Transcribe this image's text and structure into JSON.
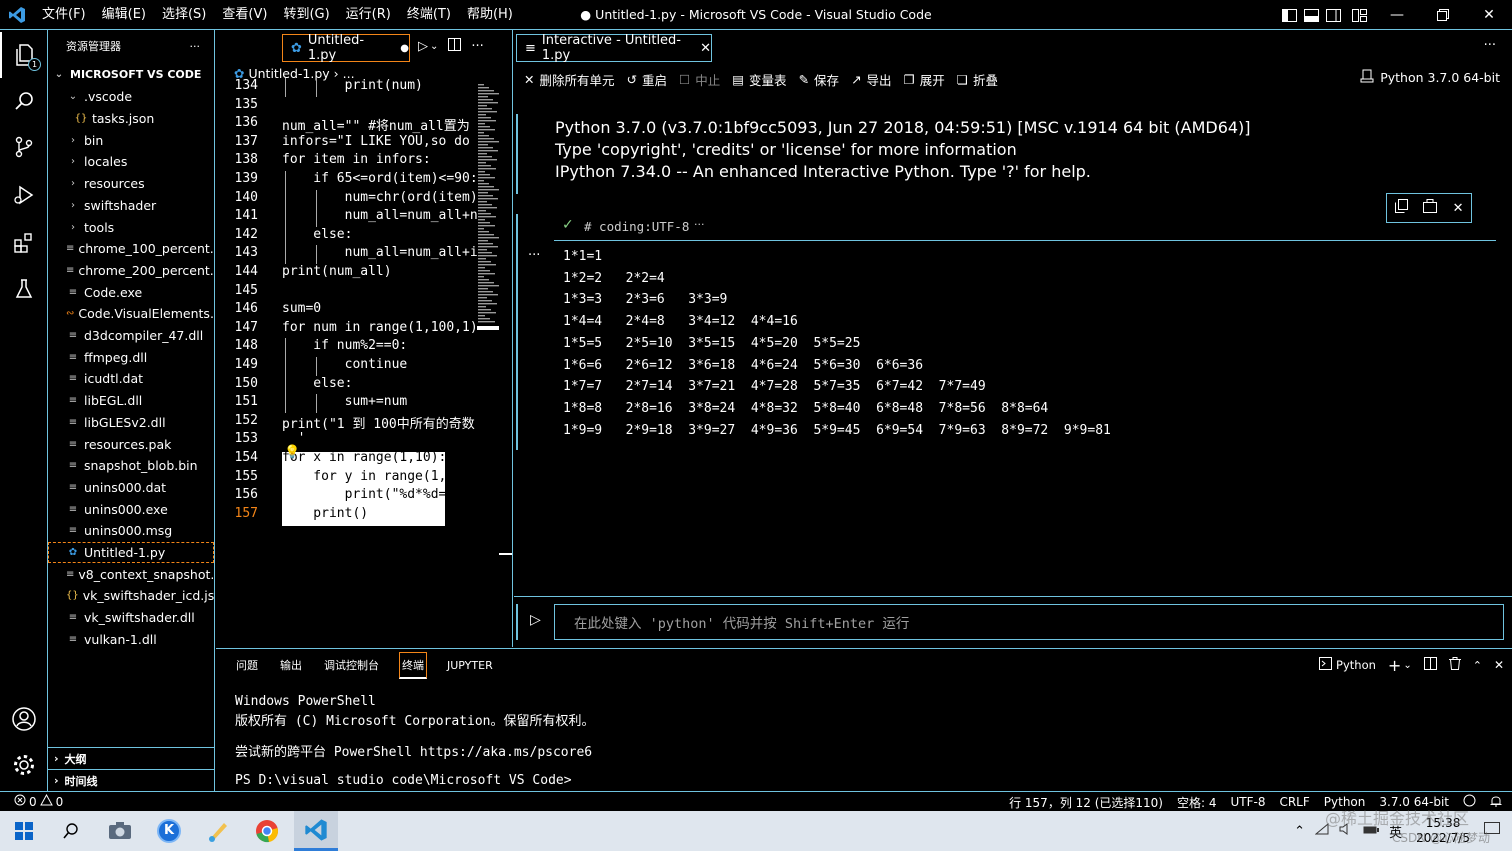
{
  "colors": {
    "accent": "#6fc3df",
    "focus": "#f38518",
    "check": "#89d185",
    "vscode_blue": "#3c9be3"
  },
  "titlebar": {
    "menu": [
      "文件(F)",
      "编辑(E)",
      "选择(S)",
      "查看(V)",
      "转到(G)",
      "运行(R)",
      "终端(T)",
      "帮助(H)"
    ],
    "title": "● Untitled-1.py - Microsoft VS Code - Visual Studio Code"
  },
  "activitybar": {
    "badge": "1"
  },
  "explorer": {
    "header": "资源管理器",
    "root": "MICROSOFT VS CODE",
    "items": [
      {
        "label": ".vscode",
        "icon": "chevron-down"
      },
      {
        "label": "tasks.json",
        "icon": "json"
      },
      {
        "label": "bin",
        "icon": "chevron-right"
      },
      {
        "label": "locales",
        "icon": "chevron-right"
      },
      {
        "label": "resources",
        "icon": "chevron-right"
      },
      {
        "label": "swiftshader",
        "icon": "chevron-right"
      },
      {
        "label": "tools",
        "icon": "chevron-right"
      },
      {
        "label": "chrome_100_percent....",
        "icon": "file"
      },
      {
        "label": "chrome_200_percent....",
        "icon": "file"
      },
      {
        "label": "Code.exe",
        "icon": "file"
      },
      {
        "label": "Code.VisualElements...",
        "icon": "rss"
      },
      {
        "label": "d3dcompiler_47.dll",
        "icon": "file"
      },
      {
        "label": "ffmpeg.dll",
        "icon": "file"
      },
      {
        "label": "icudtl.dat",
        "icon": "file"
      },
      {
        "label": "libEGL.dll",
        "icon": "file"
      },
      {
        "label": "libGLESv2.dll",
        "icon": "file"
      },
      {
        "label": "resources.pak",
        "icon": "file"
      },
      {
        "label": "snapshot_blob.bin",
        "icon": "file"
      },
      {
        "label": "unins000.dat",
        "icon": "file"
      },
      {
        "label": "unins000.exe",
        "icon": "file"
      },
      {
        "label": "unins000.msg",
        "icon": "file"
      },
      {
        "label": "Untitled-1.py",
        "icon": "python"
      },
      {
        "label": "v8_context_snapshot....",
        "icon": "file"
      },
      {
        "label": "vk_swiftshader_icd.json",
        "icon": "json"
      },
      {
        "label": "vk_swiftshader.dll",
        "icon": "file"
      },
      {
        "label": "vulkan-1.dll",
        "icon": "file"
      }
    ],
    "outline": "大纲",
    "timeline": "时间线"
  },
  "editor": {
    "tab": "Untitled-1.py",
    "breadcrumb": "Untitled-1.py",
    "breadcrumb_tail": "...",
    "lines": [
      {
        "n": "134",
        "code": "        print(num)"
      },
      {
        "n": "135",
        "code": ""
      },
      {
        "n": "136",
        "code": "num_all=\"\" #将num_all置为"
      },
      {
        "n": "137",
        "code": "infors=\"I LIKE YOU,so do"
      },
      {
        "n": "138",
        "code": "for item in infors:"
      },
      {
        "n": "139",
        "code": "    if 65<=ord(item)<=90:"
      },
      {
        "n": "140",
        "code": "        num=chr(ord(item)"
      },
      {
        "n": "141",
        "code": "        num_all=num_all+n"
      },
      {
        "n": "142",
        "code": "    else:"
      },
      {
        "n": "143",
        "code": "        num_all=num_all+i"
      },
      {
        "n": "144",
        "code": "print(num_all)"
      },
      {
        "n": "145",
        "code": ""
      },
      {
        "n": "146",
        "code": "sum=0"
      },
      {
        "n": "147",
        "code": "for num in range(1,100,1)"
      },
      {
        "n": "148",
        "code": "    if num%2==0:"
      },
      {
        "n": "149",
        "code": "        continue"
      },
      {
        "n": "150",
        "code": "    else:"
      },
      {
        "n": "151",
        "code": "        sum+=num"
      },
      {
        "n": "152",
        "code": "print(\"1 到 100中所有的奇数"
      },
      {
        "n": "153",
        "code": "  '"
      },
      {
        "n": "154",
        "code": "for x in range(1,10):"
      },
      {
        "n": "155",
        "code": "    for y in range(1,x+1)"
      },
      {
        "n": "156",
        "code": "        print(\"%d*%d=%d\""
      },
      {
        "n": "157",
        "code": "    print()"
      }
    ]
  },
  "interactive": {
    "tab": "Interactive - Untitled-1.py",
    "toolbar": [
      {
        "icon": "close-icon",
        "label": "删除所有单元"
      },
      {
        "icon": "restart-icon",
        "label": "重启"
      },
      {
        "icon": "stop-icon",
        "label": "中止"
      },
      {
        "icon": "variables-icon",
        "label": "变量表"
      },
      {
        "icon": "save-icon",
        "label": "保存"
      },
      {
        "icon": "export-icon",
        "label": "导出"
      },
      {
        "icon": "expand-icon",
        "label": "展开"
      },
      {
        "icon": "collapse-icon",
        "label": "折叠"
      }
    ],
    "kernel": "Python 3.7.0 64-bit",
    "info": [
      "Python 3.7.0 (v3.7.0:1bf9cc5093, Jun 27 2018, 04:59:51) [MSC v.1914 64 bit (AMD64)]",
      "Type 'copyright', 'credits' or 'license' for more information",
      "IPython 7.34.0 -- An enhanced Interactive Python. Type '?' for help."
    ],
    "cell_code": "# coding:UTF-8",
    "cell_more": "···",
    "output": [
      "1*1=1",
      "1*2=2   2*2=4",
      "1*3=3   2*3=6   3*3=9",
      "1*4=4   2*4=8   3*4=12  4*4=16",
      "1*5=5   2*5=10  3*5=15  4*5=20  5*5=25",
      "1*6=6   2*6=12  3*6=18  4*6=24  5*6=30  6*6=36",
      "1*7=7   2*7=14  3*7=21  4*7=28  5*7=35  6*7=42  7*7=49",
      "1*8=8   2*8=16  3*8=24  4*8=32  5*8=40  6*8=48  7*8=56  8*8=64",
      "1*9=9   2*9=18  3*9=27  4*9=36  5*9=45  6*9=54  7*9=63  8*9=72  9*9=81"
    ],
    "input_placeholder": "在此处键入 'python' 代码并按 Shift+Enter 运行"
  },
  "panel": {
    "tabs": [
      "问题",
      "输出",
      "调试控制台",
      "终端",
      "JUPYTER"
    ],
    "active_tab": "终端",
    "terminal_type": "Python",
    "terminal": [
      "Windows PowerShell",
      "版权所有 (C) Microsoft Corporation。保留所有权利。",
      "",
      "尝试新的跨平台 PowerShell https://aka.ms/pscore6",
      "",
      "PS D:\\visual studio code\\Microsoft VS Code>"
    ]
  },
  "statusbar": {
    "errors": "0",
    "warnings": "0",
    "position": "行 157，列 12 (已选择110)",
    "spaces": "空格: 4",
    "encoding": "UTF-8",
    "eol": "CRLF",
    "language": "Python",
    "interpreter": "3.7.0 64-bit"
  },
  "taskbar": {
    "ime": "英",
    "time": "15:38",
    "date": "2022/7/5",
    "watermark": "@稀土掘金技术社区",
    "watermark2": "CSDN @心随梦动"
  }
}
